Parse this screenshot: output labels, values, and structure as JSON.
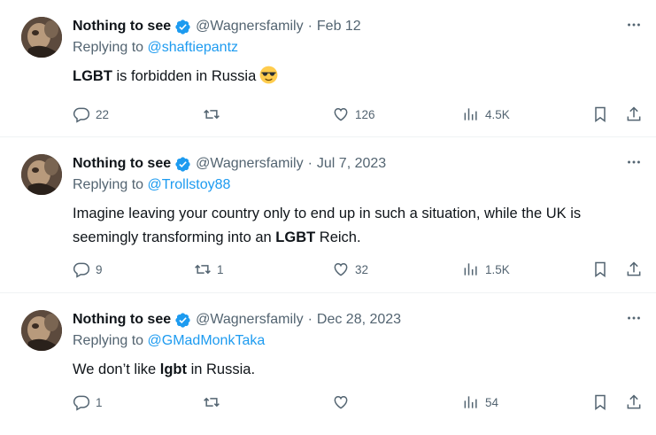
{
  "tweets": [
    {
      "name": "Nothing to see",
      "handle": "@Wagnersfamily",
      "separator": "·",
      "date": "Feb 12",
      "replying_prefix": "Replying to",
      "replying_to": "@shaftiepantz",
      "text_parts": [
        "",
        "LGBT",
        " is forbidden in Russia"
      ],
      "emoji": "sunglasses-emoji",
      "replies": "22",
      "reposts": "",
      "likes": "126",
      "views": "4.5K"
    },
    {
      "name": "Nothing to see",
      "handle": "@Wagnersfamily",
      "separator": "·",
      "date": "Jul 7, 2023",
      "replying_prefix": "Replying to",
      "replying_to": "@Trollstoy88",
      "text_parts": [
        "Imagine leaving your country only to end up in such a situation, while the UK is seemingly transforming into an ",
        "LGBT",
        " Reich."
      ],
      "replies": "9",
      "reposts": "1",
      "likes": "32",
      "views": "1.5K"
    },
    {
      "name": "Nothing to see",
      "handle": "@Wagnersfamily",
      "separator": "·",
      "date": "Dec 28, 2023",
      "replying_prefix": "Replying to",
      "replying_to": "@GMadMonkTaka",
      "text_parts": [
        "We don’t like ",
        "lgbt",
        " in Russia."
      ],
      "replies": "1",
      "reposts": "",
      "likes": "",
      "views": "54"
    }
  ],
  "icons": {
    "verified": "verified-badge-icon",
    "more": "more-icon",
    "reply": "reply-icon",
    "repost": "repost-icon",
    "like": "like-icon",
    "views": "views-icon",
    "bookmark": "bookmark-icon",
    "share": "share-icon"
  },
  "colors": {
    "accent": "#1d9bf0",
    "text": "#0f1419",
    "secondary": "#536471",
    "divider": "#eff3f4"
  }
}
